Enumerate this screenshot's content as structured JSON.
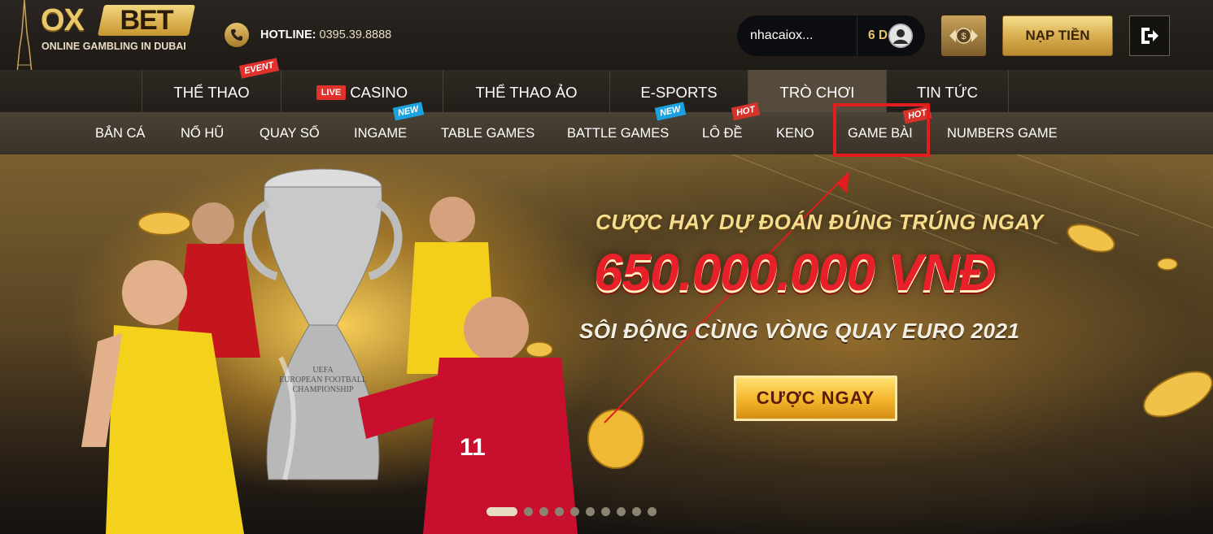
{
  "header": {
    "logo_ox": "OX",
    "logo_bet": "BET",
    "logo_tagline": "ONLINE GAMBLING IN DUBAI",
    "hotline_label": "HOTLINE:",
    "hotline_number": "0395.39.8888",
    "account_name": "nhacaiox...",
    "account_balance": "6 D",
    "deposit_label": "NẠP TIỀN"
  },
  "main_nav": {
    "items": [
      {
        "label": "THỂ THAO",
        "badge": "EVENT"
      },
      {
        "label": "CASINO",
        "live": "LIVE"
      },
      {
        "label": "THỂ THAO ẢO"
      },
      {
        "label": "E-SPORTS"
      },
      {
        "label": "TRÒ CHƠI",
        "active": true
      },
      {
        "label": "TIN TỨC"
      }
    ]
  },
  "sub_nav": {
    "items": [
      {
        "label": "BẮN CÁ"
      },
      {
        "label": "NỔ HŨ"
      },
      {
        "label": "QUAY SỐ"
      },
      {
        "label": "INGAME",
        "badge": "NEW"
      },
      {
        "label": "TABLE GAMES"
      },
      {
        "label": "BATTLE GAMES",
        "badge": "NEW"
      },
      {
        "label": "LÔ ĐỀ",
        "badge": "HOT"
      },
      {
        "label": "KENO"
      },
      {
        "label": "GAME BÀI",
        "badge": "HOT",
        "highlighted": true
      },
      {
        "label": "NUMBERS GAME"
      }
    ]
  },
  "banner": {
    "headline": "CƯỢC HAY DỰ ĐOÁN ĐÚNG TRÚNG NGAY",
    "amount": "650.000.000 VNĐ",
    "subline": "SÔI ĐỘNG CÙNG VÒNG QUAY EURO 2021",
    "cta_label": "CƯỢC NGAY",
    "trophy_text": "UEFA EUROPEAN FOOTBALL CHAMPIONSHIP",
    "slide_count": 10,
    "active_slide": 1
  },
  "colors": {
    "gold": "#e7c36a",
    "annotation_red": "#e11d1d",
    "live_red": "#e0312d",
    "new_blue": "#1aa3e0"
  }
}
